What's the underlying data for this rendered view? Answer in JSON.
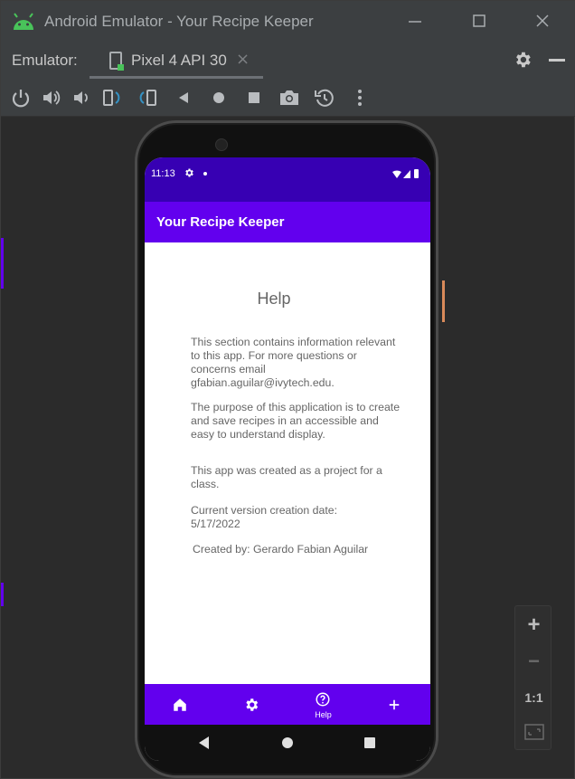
{
  "window": {
    "title": "Android Emulator - Your Recipe Keeper"
  },
  "emulator_bar": {
    "label": "Emulator:",
    "device_tab": "Pixel 4 API 30",
    "close": "×"
  },
  "toolbar": {
    "tools": [
      "power-icon",
      "volume-up-icon",
      "volume-down-icon",
      "rotate-left-icon",
      "rotate-right-icon",
      "back-icon",
      "home-icon",
      "overview-icon",
      "screenshot-icon",
      "snapshot-icon",
      "more-icon"
    ]
  },
  "phone": {
    "status": {
      "time": "11:13"
    },
    "app_title": "Your Recipe Keeper",
    "help": {
      "heading": "Help",
      "p1": "This section contains information relevant to this app. For more questions or concerns email gfabian.aguilar@ivytech.edu.",
      "p2": "The purpose of this application is to create and save recipes in an accessible and easy to understand display.",
      "p3": "This app was created as a project for a class.",
      "p4": "Current version creation date: 5/17/2022",
      "p5": "Created by: Gerardo Fabian Aguilar"
    },
    "bottom_nav": {
      "items": [
        {
          "icon": "home-icon",
          "label": ""
        },
        {
          "icon": "settings-icon",
          "label": ""
        },
        {
          "icon": "help-icon",
          "label": "Help"
        },
        {
          "icon": "add-icon",
          "label": ""
        }
      ]
    }
  },
  "zoom": {
    "in": "+",
    "out": "−",
    "one_to_one": "1:1"
  },
  "colors": {
    "primary": "#6200ee",
    "primary_dark": "#3700b3",
    "chrome": "#3c3f41",
    "background": "#2b2b2b"
  }
}
